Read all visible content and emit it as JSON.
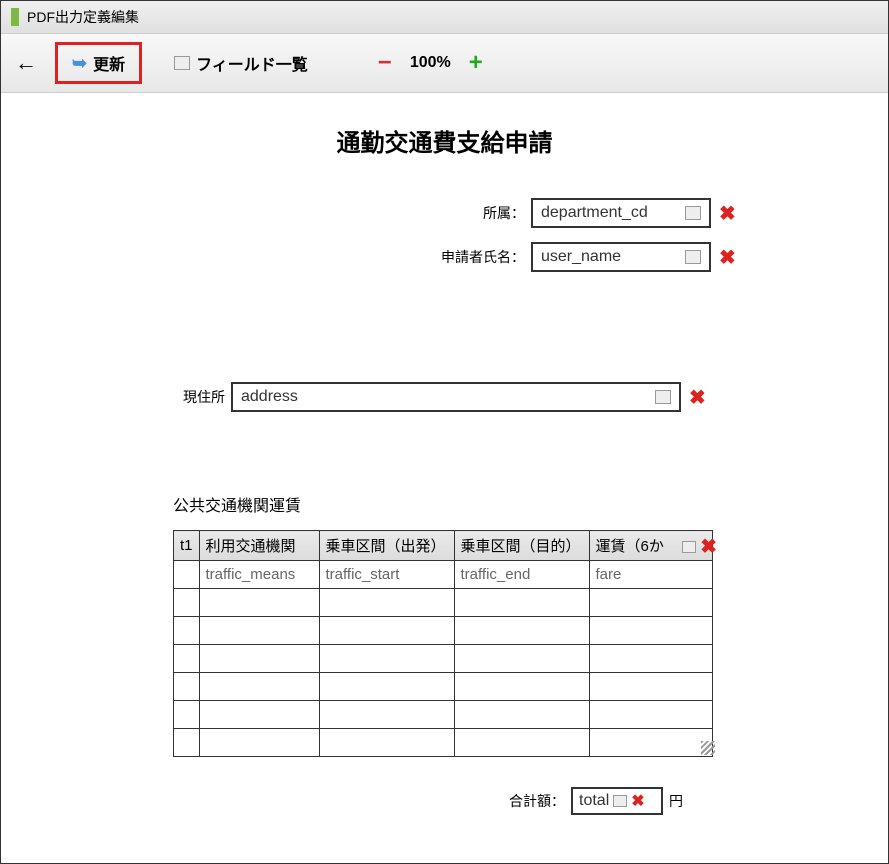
{
  "window": {
    "title": "PDF出力定義編集"
  },
  "toolbar": {
    "update_label": "更新",
    "field_list_label": "フィールド一覧",
    "zoom_text": "100%"
  },
  "form": {
    "title": "通勤交通費支給申請",
    "affiliation_label": "所属：",
    "affiliation_value": "department_cd",
    "applicant_label": "申請者氏名：",
    "applicant_value": "user_name",
    "address_label": "現住所",
    "address_value": "address",
    "table_section_label": "公共交通機関運賃",
    "total_label": "合計額：",
    "total_value": "total",
    "total_unit": "円"
  },
  "table": {
    "head": {
      "c0": "t1",
      "c1": "利用交通機関",
      "c2": "乗車区間（出発）",
      "c3": "乗車区間（目的）",
      "c4": "運賃（6か"
    },
    "row1": {
      "c1": "traffic_means",
      "c2": "traffic_start",
      "c3": "traffic_end",
      "c4": "fare"
    }
  }
}
